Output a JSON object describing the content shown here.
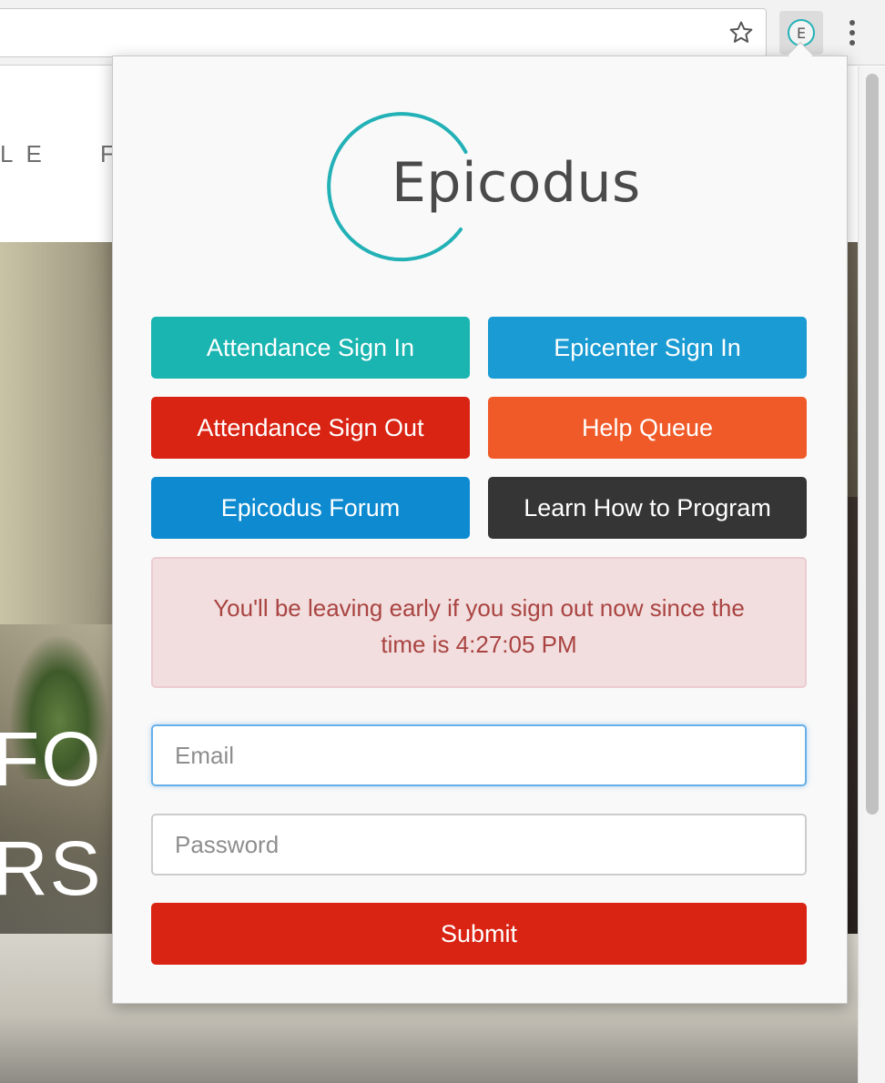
{
  "browser": {
    "bookmark_icon": "star-outline-icon",
    "extension_icon_letter": "E",
    "menu_icon": "vertical-dots-icon"
  },
  "background_page": {
    "nav_fragment_left": "LE",
    "nav_fragment_right": "F",
    "hero_line1": "FO",
    "hero_line2": "RS"
  },
  "popup": {
    "logo_text": "Epicodus",
    "buttons": [
      {
        "label": "Attendance Sign In",
        "color": "#1ab5b1"
      },
      {
        "label": "Epicenter Sign In",
        "color": "#1a9bd3"
      },
      {
        "label": "Attendance Sign Out",
        "color": "#d92313"
      },
      {
        "label": "Help Queue",
        "color": "#f05a28"
      },
      {
        "label": "Epicodus Forum",
        "color": "#0d8ad0"
      },
      {
        "label": "Learn How to Program",
        "color": "#353535"
      }
    ],
    "alert": {
      "message": "You'll be leaving early if you sign out now since the time is 4:27:05 PM"
    },
    "form": {
      "email_placeholder": "Email",
      "password_placeholder": "Password",
      "submit_label": "Submit",
      "submit_color": "#d92313"
    }
  },
  "colors": {
    "brand_teal": "#22b1b6"
  }
}
